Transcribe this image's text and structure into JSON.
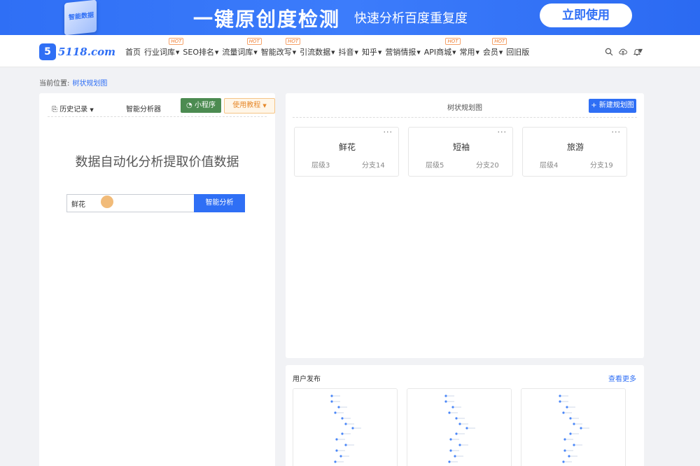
{
  "banner": {
    "cube_text": "智能数据",
    "title": "一键原创度检测",
    "subtitle": "快速分析百度重复度",
    "button": "立即使用"
  },
  "nav": {
    "logo_mark": "5",
    "logo_text": "5118.com",
    "items": [
      {
        "label": "首页",
        "caret": false,
        "hot": false
      },
      {
        "label": "行业词库",
        "caret": true,
        "hot": true
      },
      {
        "label": "SEO排名",
        "caret": true,
        "hot": false
      },
      {
        "label": "流量词库",
        "caret": true,
        "hot": true
      },
      {
        "label": "智能改写",
        "caret": true,
        "hot": true
      },
      {
        "label": "引流数据",
        "caret": true,
        "hot": false
      },
      {
        "label": "抖音",
        "caret": true,
        "hot": false
      },
      {
        "label": "知乎",
        "caret": true,
        "hot": false
      },
      {
        "label": "营销情报",
        "caret": true,
        "hot": false
      },
      {
        "label": "API商城",
        "caret": true,
        "hot": true
      },
      {
        "label": "常用",
        "caret": true,
        "hot": false
      },
      {
        "label": "会员",
        "caret": true,
        "hot": true
      },
      {
        "label": "回旧版",
        "caret": false,
        "hot": false
      }
    ],
    "hot_label": "HOT",
    "icons": [
      "search-icon",
      "cloud-upload-icon",
      "bell-icon"
    ]
  },
  "breadcrumb": {
    "prefix": "当前位置:",
    "current": "树状规划图"
  },
  "left": {
    "history_tab": "历史记录",
    "smart_tab": "智能分析器",
    "mini_program_button": "小程序",
    "tutorial_button": "使用教程",
    "headline": "数据自动化分析提取价值数据",
    "search_value": "鲜花",
    "analyze_button": "智能分析"
  },
  "right": {
    "title": "树状规划图",
    "new_button": "+ 新建规划图",
    "cards": [
      {
        "name": "鲜花",
        "level": "层级3",
        "branch": "分支14"
      },
      {
        "name": "短袖",
        "level": "层级5",
        "branch": "分支20"
      },
      {
        "name": "旅游",
        "level": "层级4",
        "branch": "分支19"
      }
    ],
    "more_dots": "···"
  },
  "user_posts": {
    "title": "用户发布",
    "more": "查看更多"
  },
  "colors": {
    "brand_blue": "#2f6ff5",
    "mini_green": "#4c8b51",
    "tutorial_orange": "#e6882a",
    "hot_orange": "#f07b2b"
  }
}
